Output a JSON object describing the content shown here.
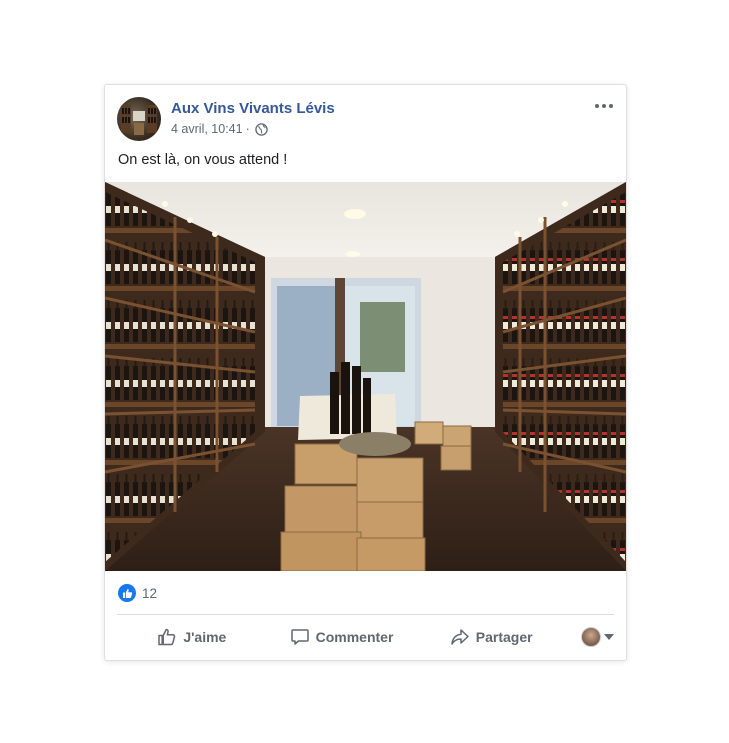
{
  "post": {
    "page_name": "Aux Vins Vivants Lévis",
    "timestamp": "4 avril, 10:41",
    "separator": "·",
    "audience_icon": "globe-icon",
    "message": "On est là, on vous attend !",
    "photo_alt": "Intérieur de la boutique de vins"
  },
  "reactions": {
    "icon": "like-icon",
    "count": "12"
  },
  "actions": {
    "like_label": "J'aime",
    "comment_label": "Commenter",
    "share_label": "Partager"
  },
  "colors": {
    "page_name": "#365899",
    "like_blue": "#1877f2",
    "action_text": "#606770"
  }
}
